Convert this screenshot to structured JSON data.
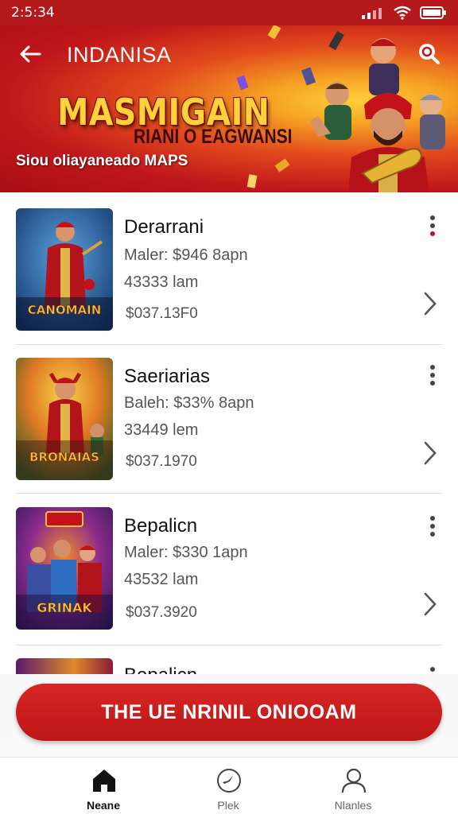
{
  "status_bar": {
    "time": "2:5:34"
  },
  "header": {
    "title": "INDANISA",
    "hero_title": "MASMIGAIN",
    "hero_subtitle": "RIANI O EAGWANSI",
    "hero_tagline": "Siou oliayaneado MAPS"
  },
  "games": [
    {
      "name": "Derarrani",
      "maker": "Maler: $946 8apn",
      "count": "43333 lam",
      "price": "$037.13F0",
      "thumb_caption": "CANOMAIN"
    },
    {
      "name": "Saeriarias",
      "maker": "Baleh: $33% 8apn",
      "count": "33449 lem",
      "price": "$037.1970",
      "thumb_caption": "BRONAIAS"
    },
    {
      "name": "Bepalicn",
      "maker": "Maler: $330 1apn",
      "count": "43532 lam",
      "price": "$037.3920",
      "thumb_caption": "GRINAK"
    },
    {
      "name": "Bepalicn",
      "maker": "",
      "count": "",
      "price": "",
      "thumb_caption": ""
    }
  ],
  "cta": {
    "label": "THE UE NRINIL ONIOOAM"
  },
  "bottom_nav": [
    {
      "label": "Neane",
      "icon": "home-icon",
      "active": true
    },
    {
      "label": "Plek",
      "icon": "compass-icon",
      "active": false
    },
    {
      "label": "Nlanles",
      "icon": "profile-icon",
      "active": false
    }
  ],
  "colors": {
    "brand_red": "#c0161b",
    "accent_gold": "#ffd23a"
  }
}
